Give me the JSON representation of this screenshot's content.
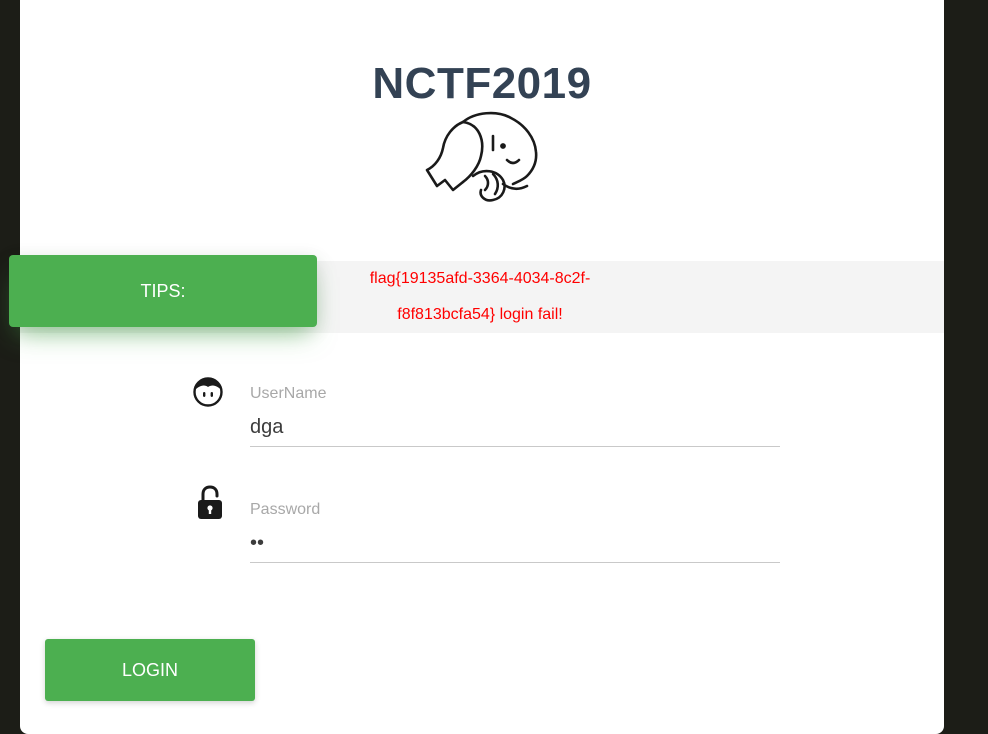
{
  "header": {
    "title": "NCTF2019",
    "logo_icon": "elephant-icon"
  },
  "tips": {
    "label": "TIPS:",
    "message_line1": "flag{19135afd-3364-4034-8c2f-",
    "message_line2": "f8f813bcfa54} login fail!"
  },
  "form": {
    "username": {
      "label": "UserName",
      "value": "dga",
      "icon": "boy-face-icon"
    },
    "password": {
      "label": "Password",
      "value": "••",
      "icon": "unlocked-padlock-icon"
    },
    "login_label": "LOGIN"
  },
  "colors": {
    "accent": "#4caf50",
    "error": "#ff0000",
    "title": "#334254",
    "backdrop": "#1c1d17"
  }
}
